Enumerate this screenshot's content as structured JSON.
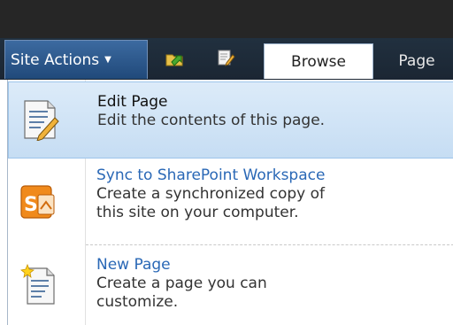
{
  "ribbon": {
    "site_actions_label": "Site Actions",
    "tabs": [
      {
        "label": "Browse",
        "selected": true
      },
      {
        "label": "Page",
        "selected": false
      }
    ]
  },
  "menu": {
    "items": [
      {
        "title": "Edit Page",
        "description": "Edit the contents of this page.",
        "icon": "edit-page-icon",
        "highlighted": true
      },
      {
        "title": "Sync to SharePoint Workspace",
        "description_lines": [
          "Create a synchronized copy of",
          "this site on your computer."
        ],
        "icon": "sharepoint-workspace-icon"
      },
      {
        "title": "New Page",
        "description_lines": [
          "Create a page you can",
          "customize."
        ],
        "icon": "new-page-icon"
      }
    ]
  },
  "colors": {
    "ribbon_bg": "#262626",
    "site_actions_bg": "#2f5b8f",
    "link": "#2a68b6",
    "highlight": "#cfe3f6"
  }
}
